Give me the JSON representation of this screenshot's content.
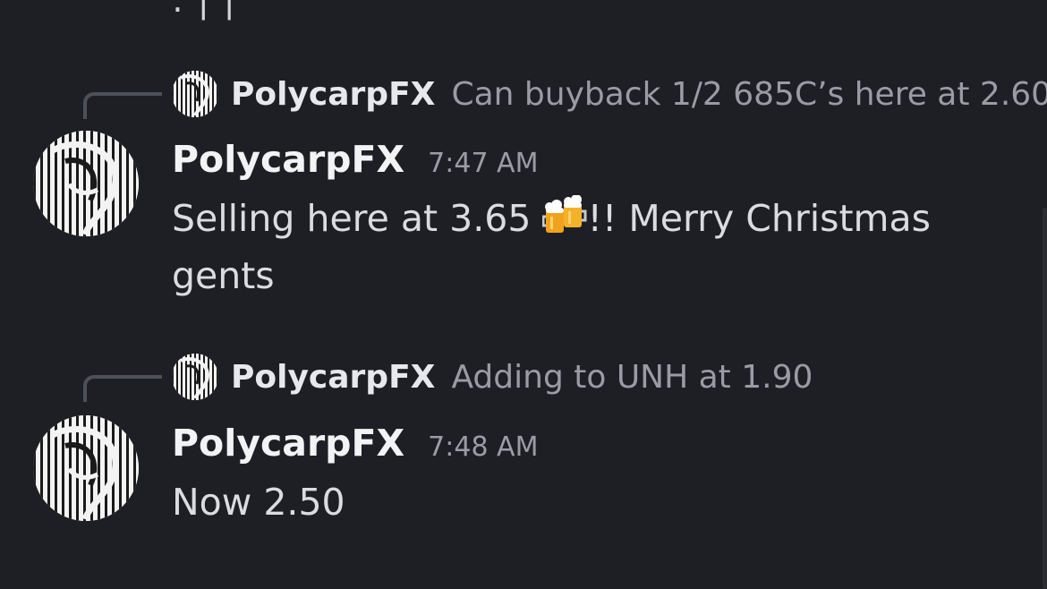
{
  "top_fragment": ": | |",
  "messages": [
    {
      "reply": {
        "author": "PolycarpFX",
        "text": "Can buyback 1/2 685C’s here at 2.60"
      },
      "author": "PolycarpFX",
      "time": "7:47 AM",
      "body_before_emoji": "Selling here at 3.65 ",
      "emoji": "beer-mugs-icon",
      "body_after_emoji": "!! Merry Christmas gents"
    },
    {
      "reply": {
        "author": "PolycarpFX",
        "text": "Adding to UNH at 1.90"
      },
      "author": "PolycarpFX",
      "time": "7:48 AM",
      "body": "Now 2.50"
    }
  ],
  "colors": {
    "background": "#1e1f24",
    "author": "#f2f3f5",
    "body_text": "#dbdce0",
    "muted_text": "#9b9ca3",
    "reply_line": "#4e5058"
  }
}
